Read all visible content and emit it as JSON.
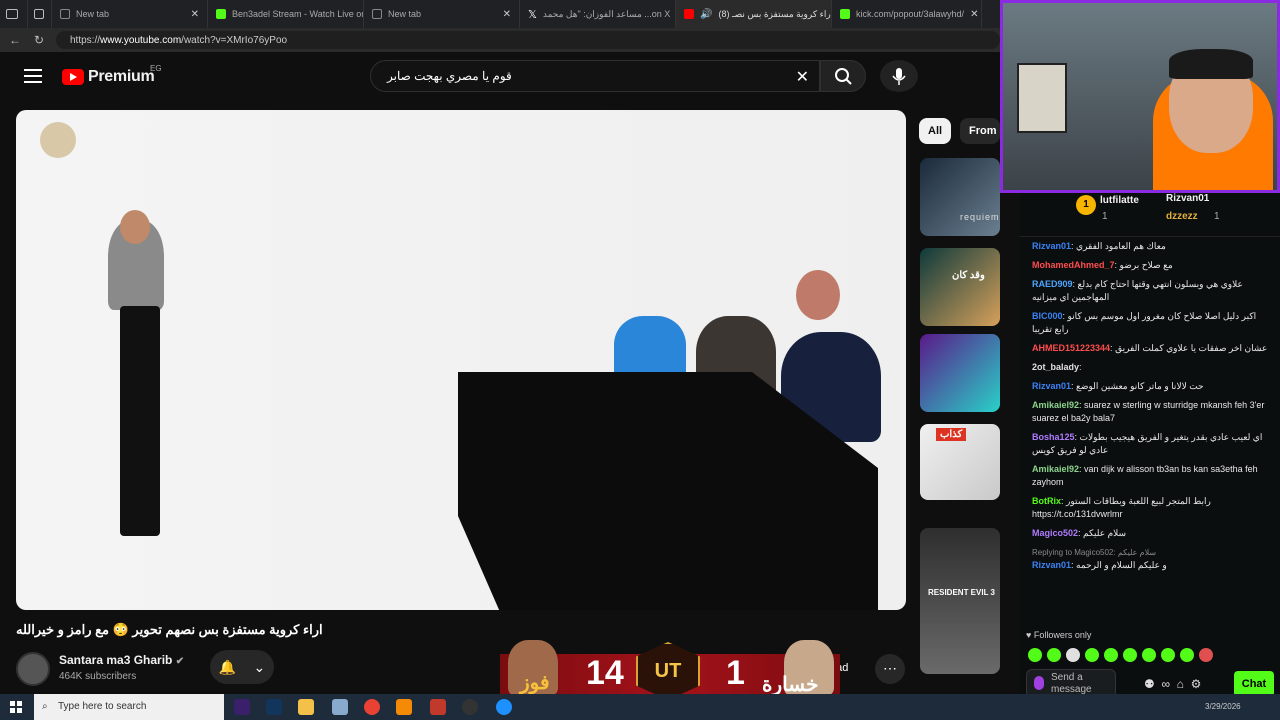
{
  "browser": {
    "tabs": [
      {
        "title": "New tab",
        "color": "#4a4a4a"
      },
      {
        "title": "Ben3adel Stream - Watch Live on",
        "color": "#53fc18"
      },
      {
        "title": "New tab",
        "color": "#4a4a4a"
      },
      {
        "title": "مساعد الفوزان: \"هل محمد ...on X",
        "color": "#ffffff"
      },
      {
        "title": "(8) اراء كروية مستفزة بس نصـ",
        "color": "#ff0000"
      },
      {
        "title": "kick.com/popout/3alawyhd/",
        "color": "#53fc18"
      }
    ],
    "url_prefix": "https://",
    "url_host": "www.youtube.com",
    "url_path": "/watch?v=XMrIo76yPoo"
  },
  "youtube": {
    "brand": "Premium",
    "country": "EG",
    "search_value": "قوم يا مصري بهجت صابر",
    "chips": [
      "All",
      "From"
    ],
    "video_title": "اراء كروية مستفزة بس نصهم تحوير 😳 مع رامز و خيرالله",
    "channel_name": "Santara ma3 Gharib",
    "subscribers": "464K subscribers",
    "download_label": "oad",
    "recs": [
      {
        "label": "requiem"
      },
      {
        "label": "وقد كان"
      },
      {
        "label": ""
      },
      {
        "label": "كذاب"
      },
      {
        "label": "RESIDENT EVIL 3"
      }
    ]
  },
  "overlay": {
    "score_left": "14",
    "score_right": "1",
    "win": "فوز",
    "lose": "خسارة",
    "ut": "UT",
    "ut_sub": "CHAMPIONS"
  },
  "chat": {
    "leaders": [
      {
        "rank": "1",
        "name": "lutfilatte",
        "count": "1"
      },
      {
        "rank": "",
        "name": "Rizvan01",
        "count": "1"
      },
      {
        "rank": "",
        "name": "dzzezz",
        "count": "1"
      }
    ],
    "messages": [
      {
        "user": "Rizvan01",
        "color": "#3b82f6",
        "text": "معاك هم العامود الفقري"
      },
      {
        "user": "MohamedAhmed_7",
        "color": "#ff4d4d",
        "text": "مع صلاح برضو"
      },
      {
        "user": "RAED909",
        "color": "#4da6ff",
        "text": "علاوي هي وبسلون انتهي وقتها احتاج كام بدلع المهاجمين اي ميزانيه"
      },
      {
        "user": "BIC000",
        "color": "#3b82f6",
        "text": "اكبر دليل اصلا صلاح كان مغرور اول موسم بس كانو رابع تقريبا"
      },
      {
        "user": "AHMED151223344",
        "color": "#ff4d4d",
        "text": "عشان اخر صفقات يا علاوي كملت الفريق"
      },
      {
        "user": "2ot_balady",
        "color": "#e0e0e0",
        "text": ""
      },
      {
        "user": "Rizvan01",
        "color": "#3b82f6",
        "text": "حت لالانا و ماتر كانو معشين الوضع"
      },
      {
        "user": "Amikaiel92",
        "color": "#8cd48c",
        "text": "suarez w sterling w sturridge mkansh feh 3'er suarez el ba2y bala7"
      },
      {
        "user": "Bosha125",
        "color": "#b07cff",
        "text": "اي لعيب عادي بقدر يتغير و الفريق هيجيب بطولات عادي لو فريق كويس"
      },
      {
        "user": "Amikaiel92",
        "color": "#8cd48c",
        "text": "van dijk w alisson tb3an bs kan sa3etha feh zayhom"
      },
      {
        "user": "BotRix",
        "color": "#53fc18",
        "text": "رابط المتجر لبيع اللعبة وبطاقات الستور https://t.co/131dvwrlmr"
      },
      {
        "user": "Magico502",
        "color": "#b07cff",
        "text": "سلام عليكم"
      },
      {
        "user": "Rizvan01",
        "color": "#3b82f6",
        "text": "و عليكم السلام و الرحمه"
      }
    ],
    "reply_to": "Replying to Magico502:",
    "reply_quote": "سلام عليكم",
    "followers_only": "Followers only",
    "send_placeholder": "Send a message",
    "chat_button": "Chat"
  },
  "taskbar": {
    "search_placeholder": "Type here to search",
    "date": "3/29/2026"
  }
}
